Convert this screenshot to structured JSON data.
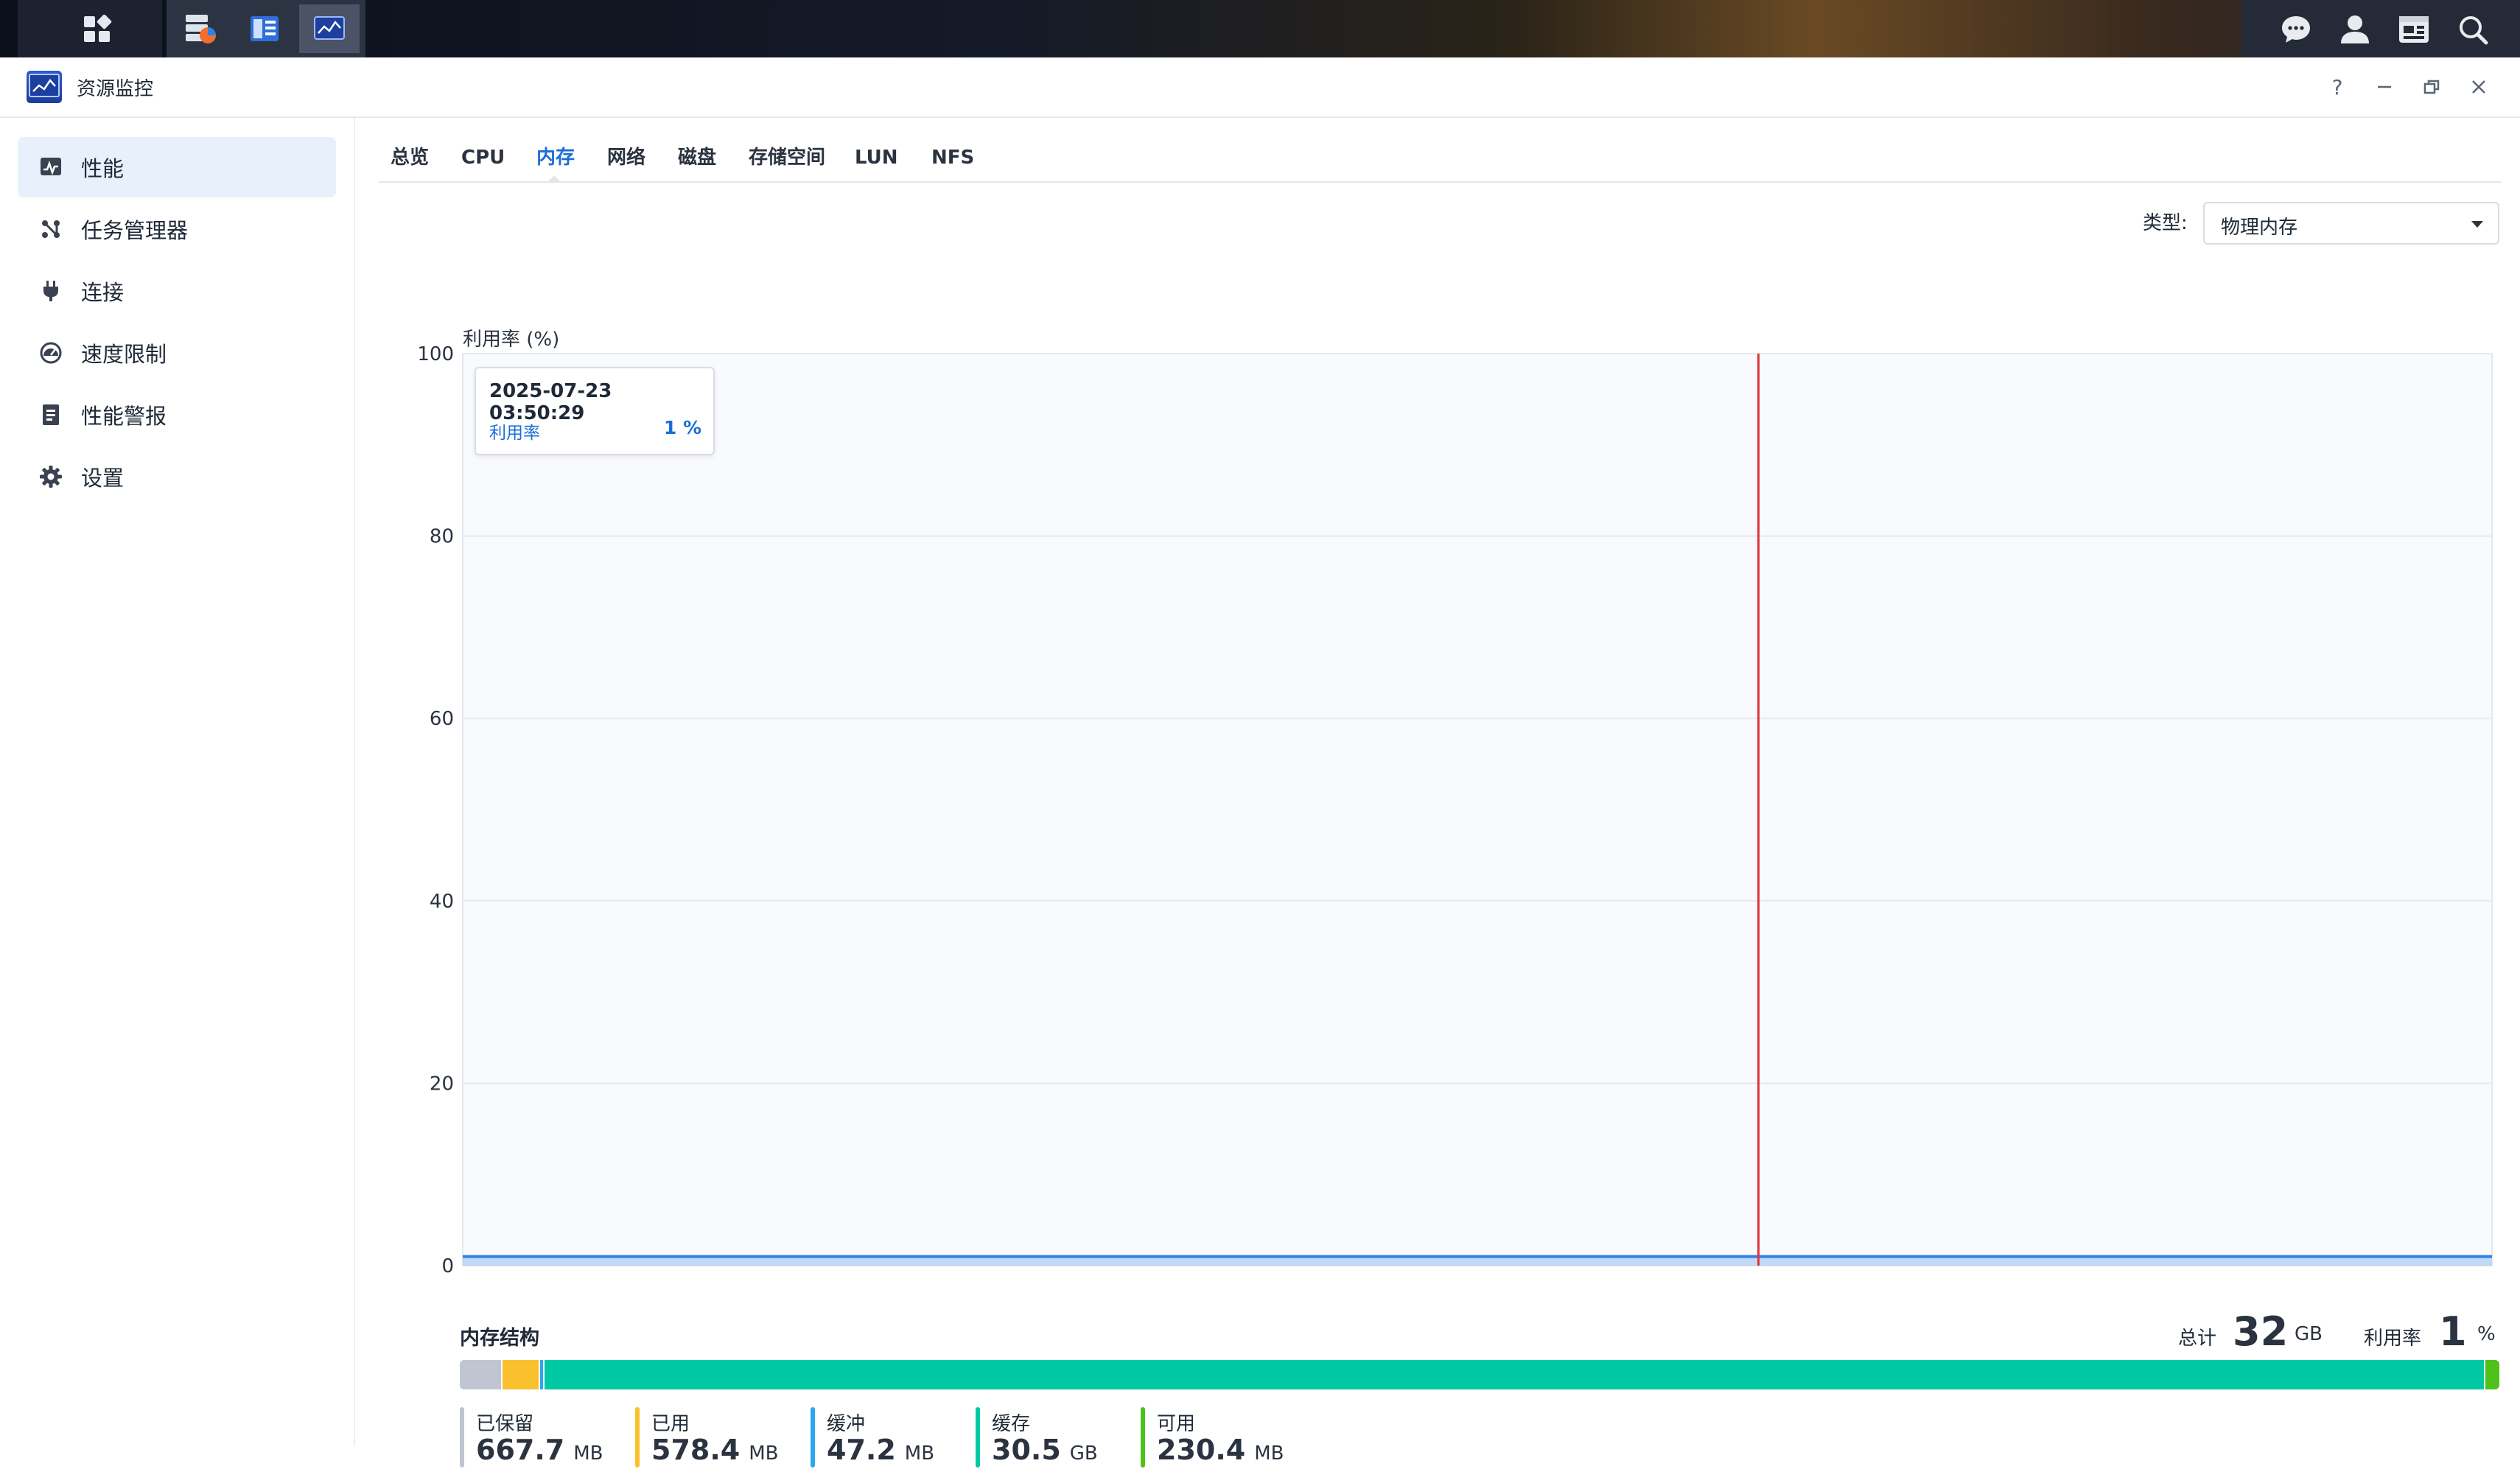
{
  "window": {
    "title": "资源监控",
    "help": "?",
    "minimize": "─",
    "restore": "🗗",
    "close": "✕"
  },
  "sidebar": {
    "items": [
      {
        "label": "性能",
        "icon": "performance-chart-icon",
        "active": true
      },
      {
        "label": "任务管理器",
        "icon": "task-manager-icon",
        "active": false
      },
      {
        "label": "连接",
        "icon": "plug-icon",
        "active": false
      },
      {
        "label": "速度限制",
        "icon": "speedometer-icon",
        "active": false
      },
      {
        "label": "性能警报",
        "icon": "alert-document-icon",
        "active": false
      },
      {
        "label": "设置",
        "icon": "gear-icon",
        "active": false
      }
    ]
  },
  "tabs": [
    {
      "label": "总览",
      "active": false
    },
    {
      "label": "CPU",
      "active": false
    },
    {
      "label": "内存",
      "active": true
    },
    {
      "label": "网络",
      "active": false
    },
    {
      "label": "磁盘",
      "active": false
    },
    {
      "label": "存储空间",
      "active": false
    },
    {
      "label": "LUN",
      "active": false
    },
    {
      "label": "NFS",
      "active": false
    }
  ],
  "type_filter": {
    "label": "类型:",
    "value": "物理内存"
  },
  "chart_data": {
    "type": "area",
    "ylabel": "利用率 (%)",
    "ylim": [
      0,
      100
    ],
    "y_ticks": [
      "0",
      "20",
      "40",
      "60",
      "80",
      "100"
    ],
    "grid": true,
    "series": [
      {
        "values": [
          1,
          1,
          1,
          1,
          1,
          1,
          1,
          1,
          1,
          1,
          1,
          1,
          1,
          1,
          1,
          1,
          1,
          1,
          1,
          1,
          1
        ],
        "color": "#2f80e8"
      }
    ],
    "cursor_color": "#e0343c",
    "tooltip": {
      "time": "2025-07-23 03:50:29",
      "label": "利用率",
      "value": "1 %"
    }
  },
  "memory_structure": {
    "title": "内存结构",
    "total_label": "总计",
    "total_value": "32",
    "total_unit": "GB",
    "util_label": "利用率",
    "util_value": "1",
    "util_unit": "%",
    "segments": [
      {
        "label": "已保留",
        "value": "667.7",
        "unit": "MB",
        "color": "#bfc6d1",
        "fraction": 0.0204
      },
      {
        "label": "已用",
        "value": "578.4",
        "unit": "MB",
        "color": "#fbc02d",
        "fraction": 0.0176
      },
      {
        "label": "缓冲",
        "value": "47.2",
        "unit": "MB",
        "color": "#2aa7ef",
        "fraction": 0.0014
      },
      {
        "label": "缓存",
        "value": "30.5",
        "unit": "GB",
        "color": "#00c8a4",
        "fraction": 0.9537
      },
      {
        "label": "可用",
        "value": "230.4",
        "unit": "MB",
        "color": "#4cc21a",
        "fraction": 0.007
      }
    ]
  },
  "taskbar": {
    "left_icon": "app-grid-icon",
    "apps": [
      "storage-manager-icon",
      "file-station-icon",
      "resource-monitor-icon"
    ],
    "right_icons": [
      "chat-icon",
      "user-icon",
      "widgets-icon",
      "search-icon"
    ]
  }
}
